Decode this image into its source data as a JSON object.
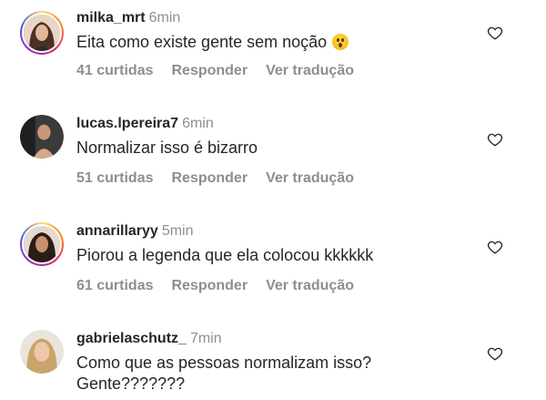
{
  "comments": [
    {
      "username": "milka_mrt",
      "time": "6min",
      "text": "Eita como existe gente sem noção",
      "emoji": "hushed-face-emoji",
      "likes": "41 curtidas",
      "reply": "Responder",
      "translate": "Ver tradução"
    },
    {
      "username": "lucas.lpereira7",
      "time": "6min",
      "text": "Normalizar isso é bizarro",
      "likes": "51 curtidas",
      "reply": "Responder",
      "translate": "Ver tradução"
    },
    {
      "username": "annarillaryy",
      "time": "5min",
      "text": "Piorou a legenda que ela colocou kkkkkk",
      "likes": "61 curtidas",
      "reply": "Responder",
      "translate": "Ver tradução"
    },
    {
      "username": "gabrielaschutz_",
      "time": "7min",
      "text_line1": "Como que as pessoas normalizam isso?",
      "text_line2": "Gente???????"
    }
  ],
  "icons": {
    "like": "heart-outline-icon"
  },
  "colors": {
    "text": "#262626",
    "secondary": "#8e8e8e"
  }
}
